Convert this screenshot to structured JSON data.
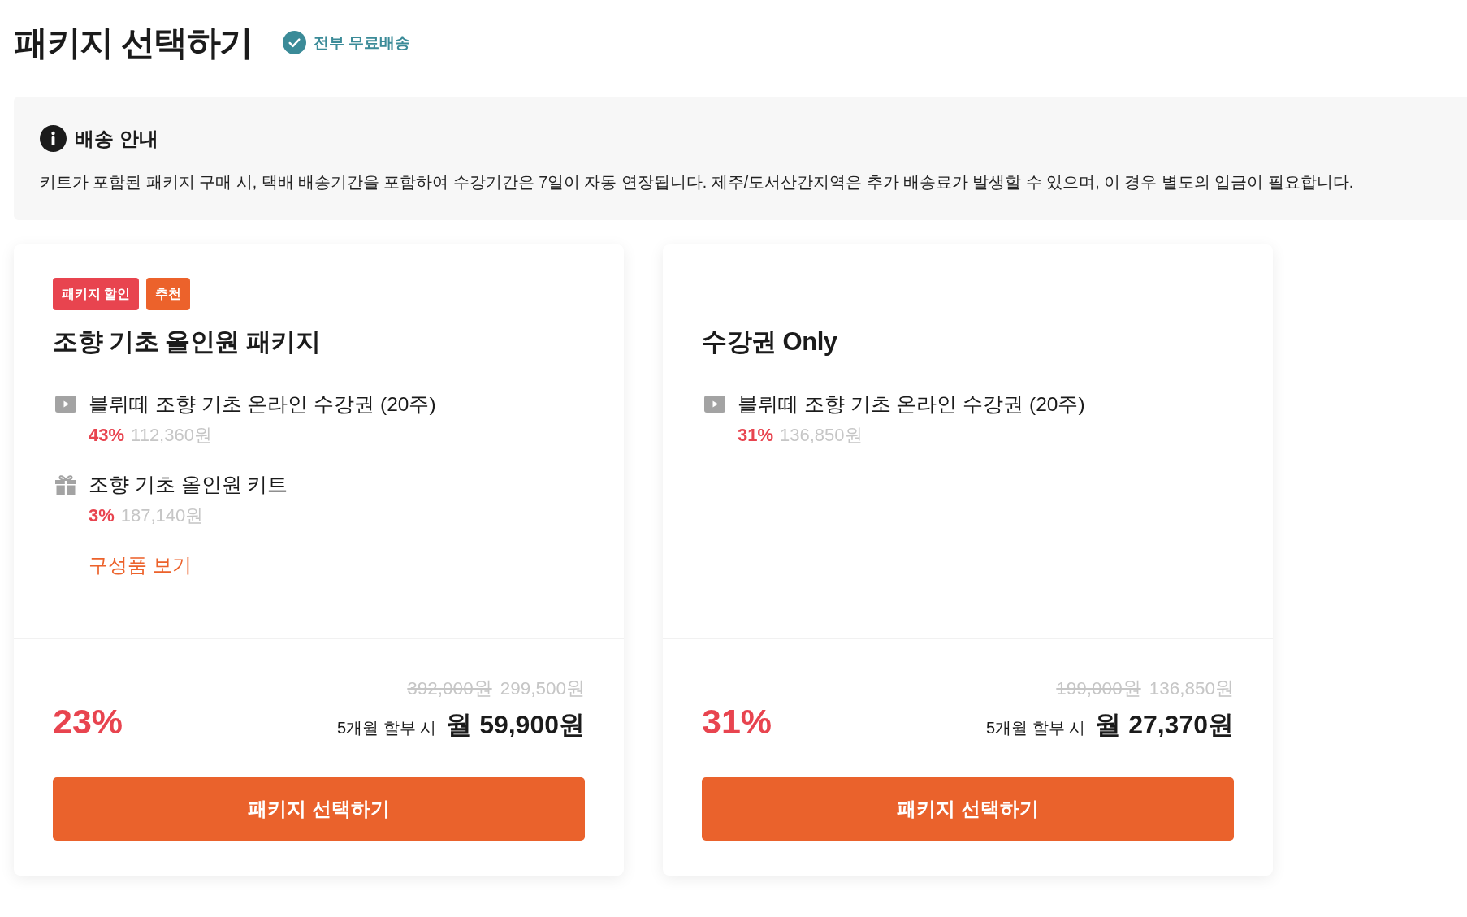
{
  "title": "패키지 선택하기",
  "shipping_badge": {
    "label": "전부 무료배송"
  },
  "notice": {
    "title": "배송 안내",
    "body": "키트가 포함된 패키지 구매 시, 택배 배송기간을 포함하여 수강기간은 7일이 자동 연장됩니다. 제주/도서산간지역은 추가 배송료가 발생할 수 있으며, 이 경우 별도의 입금이 필요합니다."
  },
  "packages": [
    {
      "badges": [
        {
          "label": "패키지 할인",
          "color": "#e8444f"
        },
        {
          "label": "추천",
          "color": "#ec622b"
        }
      ],
      "name": "조향 기초 올인원 패키지",
      "items": [
        {
          "kind": "video",
          "name": "블뤼떼 조향 기초 온라인 수강권 (20주)",
          "discount": "43%",
          "price": "112,360원"
        },
        {
          "kind": "gift",
          "name": "조향 기초 올인원 키트",
          "discount": "3%",
          "price": "187,140원"
        }
      ],
      "link": "구성품 보기",
      "original_price": "392,000원",
      "sale_price": "299,500원",
      "discount": "23%",
      "installment_label": "5개월 할부 시",
      "monthly_price": "월 59,900원",
      "button": "패키지 선택하기"
    },
    {
      "name": "수강권 Only",
      "items": [
        {
          "kind": "video",
          "name": "블뤼떼 조향 기초 온라인 수강권 (20주)",
          "discount": "31%",
          "price": "136,850원"
        }
      ],
      "original_price": "199,000원",
      "sale_price": "136,850원",
      "discount": "31%",
      "installment_label": "5개월 할부 시",
      "monthly_price": "월 27,370원",
      "button": "패키지 선택하기"
    }
  ]
}
